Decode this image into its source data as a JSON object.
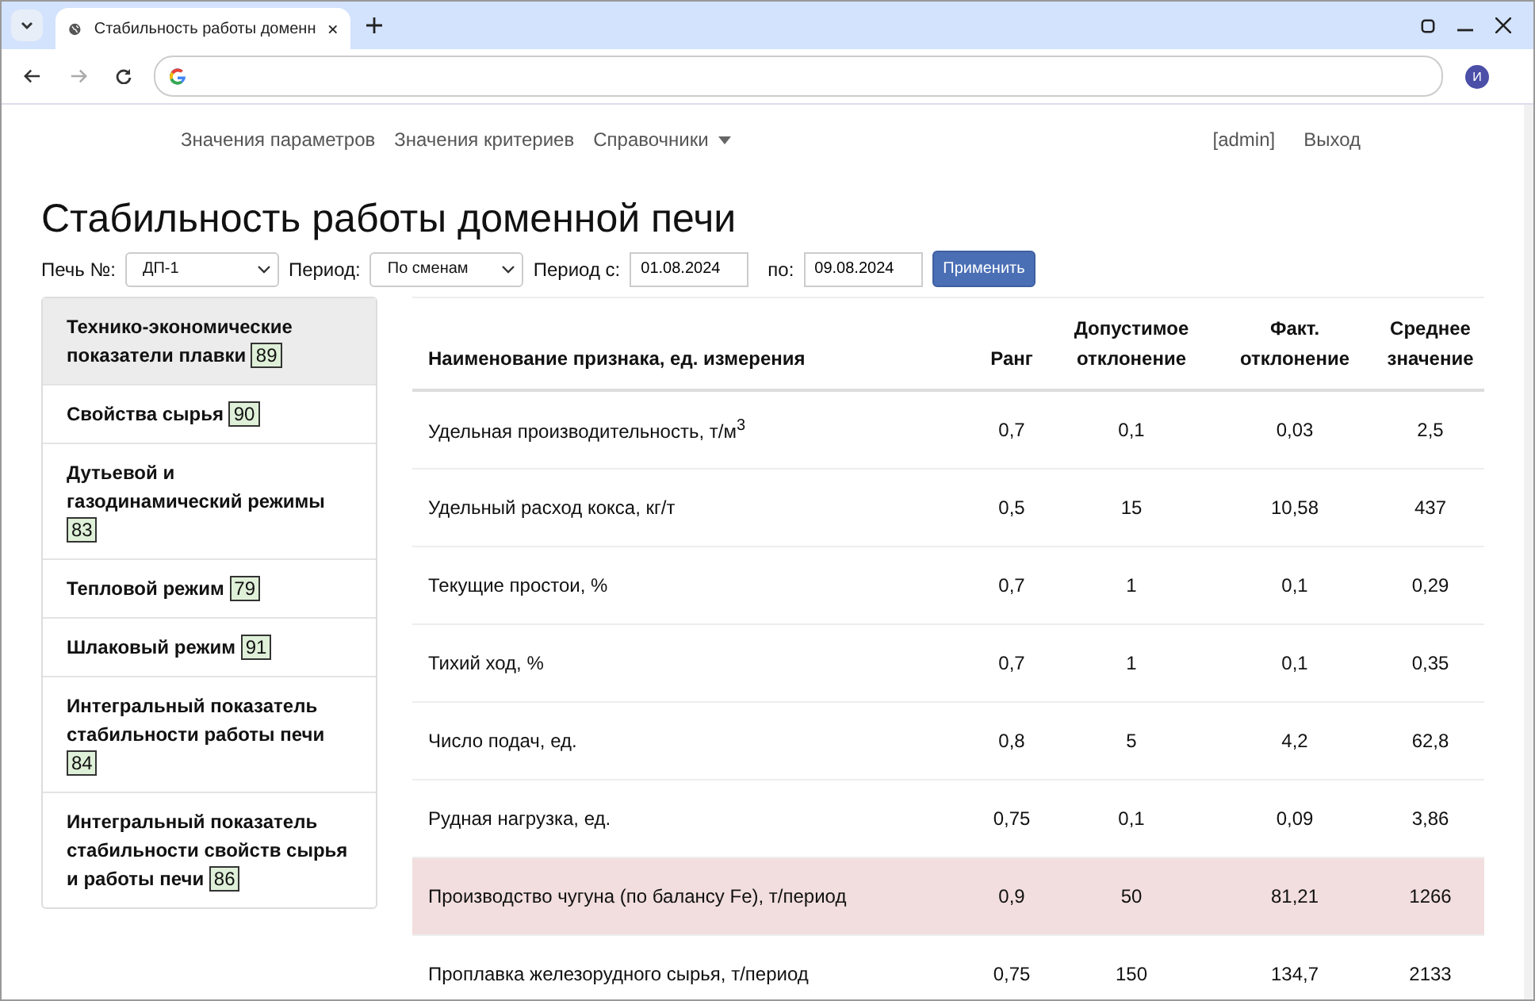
{
  "browser": {
    "tab_title": "Стабильность работы доменн",
    "profile_initial": "И"
  },
  "nav": {
    "links": [
      {
        "label": "Значения параметров",
        "kind": "link"
      },
      {
        "label": "Значения критериев",
        "kind": "link"
      },
      {
        "label": "Справочники",
        "kind": "dropdown"
      }
    ],
    "user": "[admin]",
    "logout": "Выход"
  },
  "title": "Стабильность работы доменной печи",
  "filters": {
    "furnace_label": "Печь №:",
    "furnace": "ДП-1",
    "period_label": "Период:",
    "period": "По сменам",
    "from_label": "Период с:",
    "from": "01.08.2024",
    "to_label": "по:",
    "to": "09.08.2024",
    "apply": "Применить"
  },
  "sidebar": {
    "items": [
      {
        "label": "Технико-экономические показатели плавки",
        "badge": "89",
        "selected": true
      },
      {
        "label": "Свойства сырья",
        "badge": "90",
        "selected": false
      },
      {
        "label": "Дутьевой и газодинамический режимы",
        "badge": "83",
        "selected": false
      },
      {
        "label": "Тепловой режим",
        "badge": "79",
        "selected": false
      },
      {
        "label": "Шлаковый режим",
        "badge": "91",
        "selected": false
      },
      {
        "label": "Интегральный показатель стабильности работы печи",
        "badge": "84",
        "selected": false
      },
      {
        "label": "Интегральный показатель стабильности свойств сырья и работы печи",
        "badge": "86",
        "selected": false
      }
    ]
  },
  "table": {
    "columns": [
      "Наименование признака, ед. измерения",
      "Ранг",
      "Допустимое отклонение",
      "Факт. отклонение",
      "Среднее значение"
    ],
    "rows": [
      {
        "cells": [
          "Удельная производительность, т/м$^{3}$",
          "0,7",
          "0,1",
          "0,03",
          "2,5"
        ],
        "highlighted": false
      },
      {
        "cells": [
          "Удельный расход кокса, кг/т",
          "0,5",
          "15",
          "10,58",
          "437"
        ],
        "highlighted": false
      },
      {
        "cells": [
          "Текущие простои, %",
          "0,7",
          "1",
          "0,1",
          "0,29"
        ],
        "highlighted": false
      },
      {
        "cells": [
          "Тихий ход, %",
          "0,7",
          "1",
          "0,1",
          "0,35"
        ],
        "highlighted": false
      },
      {
        "cells": [
          "Число подач, ед.",
          "0,8",
          "5",
          "4,2",
          "62,8"
        ],
        "highlighted": false
      },
      {
        "cells": [
          "Рудная нагрузка, ед.",
          "0,75",
          "0,1",
          "0,09",
          "3,86"
        ],
        "highlighted": false
      },
      {
        "cells": [
          "Производство чугуна (по балансу Fe), т/период",
          "0,9",
          "50",
          "81,21",
          "1266"
        ],
        "highlighted": true
      },
      {
        "cells": [
          "Проплавка железорудного сырья, т/период",
          "0,75",
          "150",
          "134,7",
          "2133"
        ],
        "highlighted": false
      }
    ]
  }
}
